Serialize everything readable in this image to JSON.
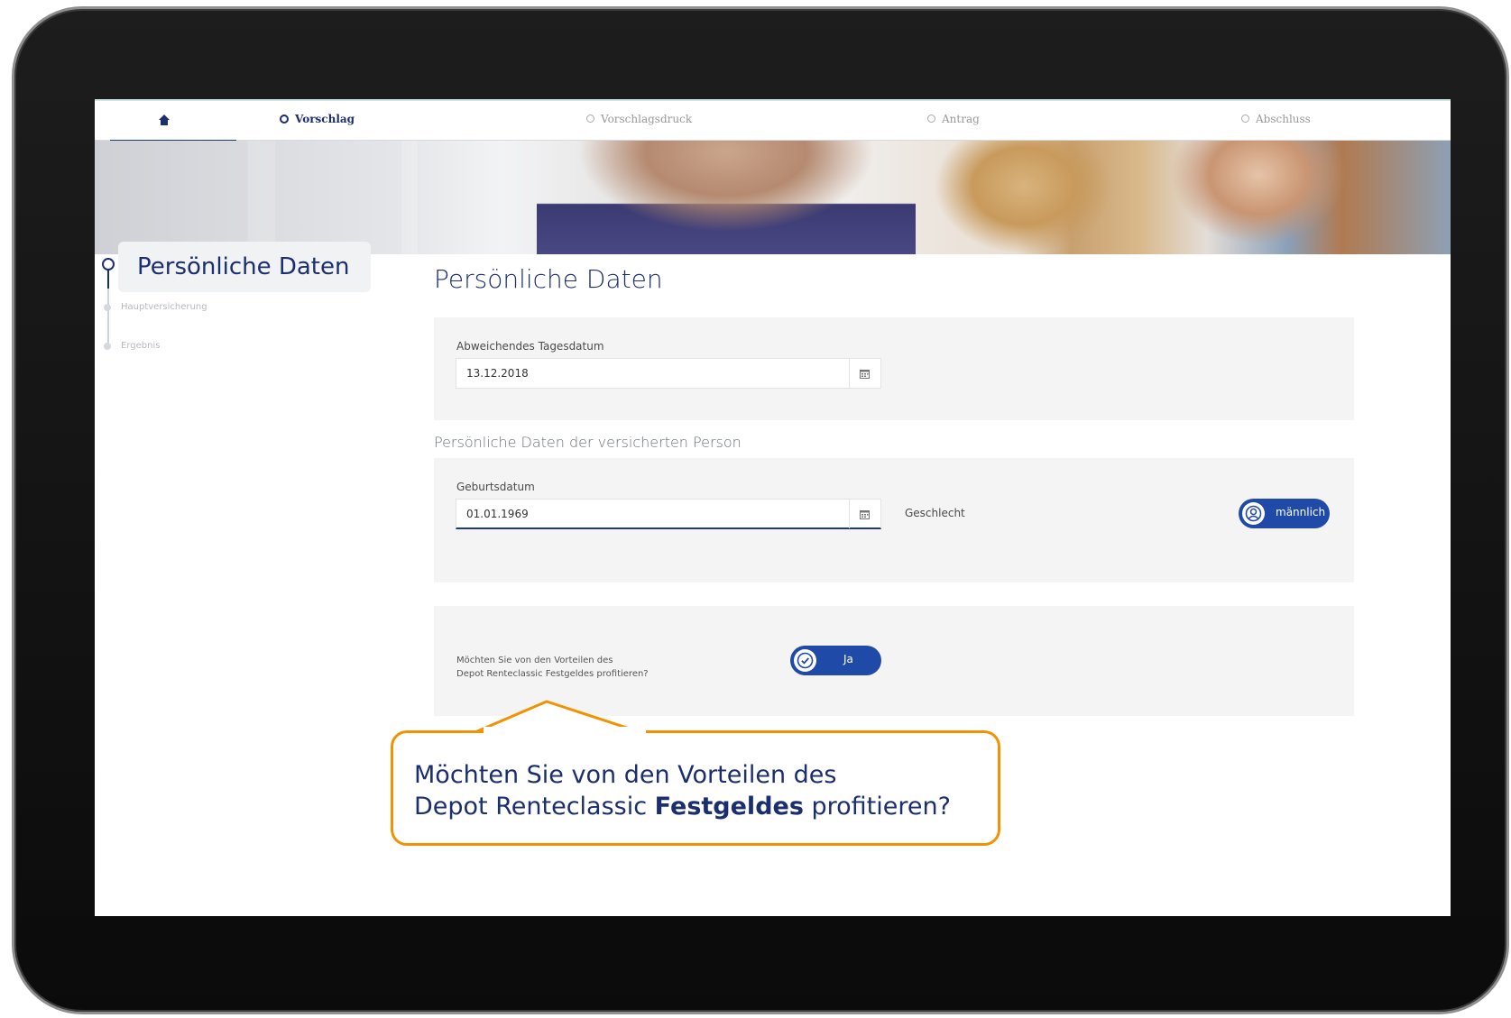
{
  "nav": {
    "home_icon": "house-icon",
    "steps": [
      {
        "label": "Vorschlag",
        "active": true
      },
      {
        "label": "Vorschlagsdruck",
        "active": false
      },
      {
        "label": "Antrag",
        "active": false
      },
      {
        "label": "Abschluss",
        "active": false
      }
    ]
  },
  "sidebar": {
    "active_step": "Persönliche Daten",
    "steps": [
      "Hauptversicherung",
      "Ergebnis"
    ]
  },
  "main": {
    "title": "Persönliche Daten",
    "date_section": {
      "label": "Abweichendes Tagesdatum",
      "value": "13.12.2018",
      "icon": "calendar-icon"
    },
    "person_section": {
      "heading": "Persönliche Daten der versicherten Person",
      "birth_label": "Geburtsdatum",
      "birth_value": "01.01.1969",
      "gender_label": "Geschlecht",
      "gender_value": "männlich",
      "gender_icon": "person-icon"
    },
    "question": {
      "line1": "Möchten Sie von den Vorteilen des",
      "line2": "Depot Renteclassic Festgeldes profitieren?",
      "answer": "Ja",
      "icon": "check-icon"
    }
  },
  "callout": {
    "line1": "Möchten Sie von den Vorteilen des",
    "line2_before": "Depot Renteclassic ",
    "line2_bold": "Festgeldes",
    "line2_after": " profitieren?"
  },
  "colors": {
    "brand_blue": "#1b2e6e",
    "toggle_blue": "#1f4aa8",
    "callout_orange": "#f39200"
  }
}
